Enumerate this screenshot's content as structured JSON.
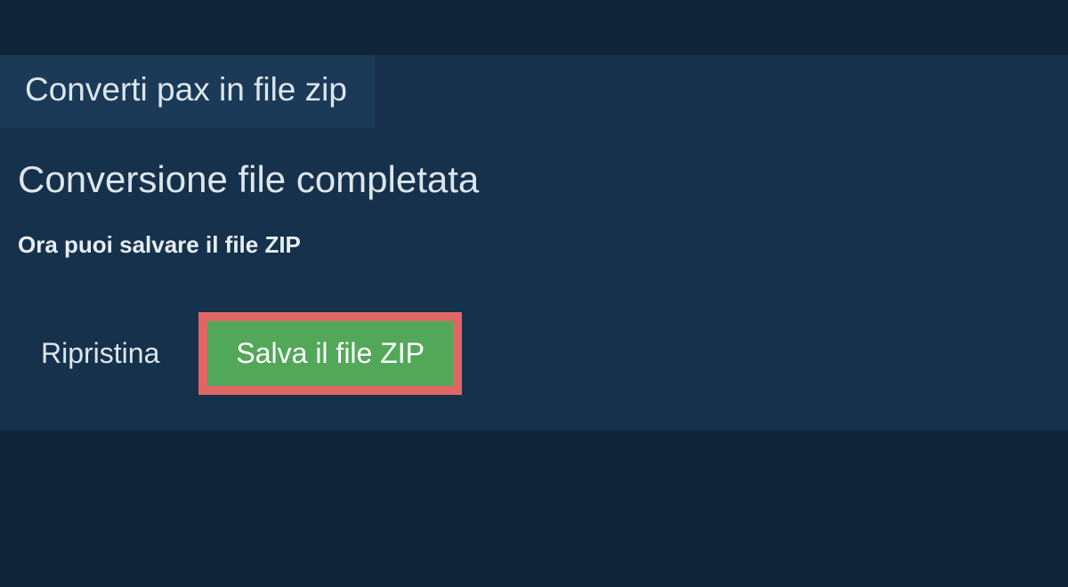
{
  "tab": {
    "label": "Converti pax in file zip"
  },
  "main": {
    "heading": "Conversione file completata",
    "subheading": "Ora puoi salvare il file ZIP"
  },
  "actions": {
    "reset_label": "Ripristina",
    "save_label": "Salva il file ZIP"
  }
}
